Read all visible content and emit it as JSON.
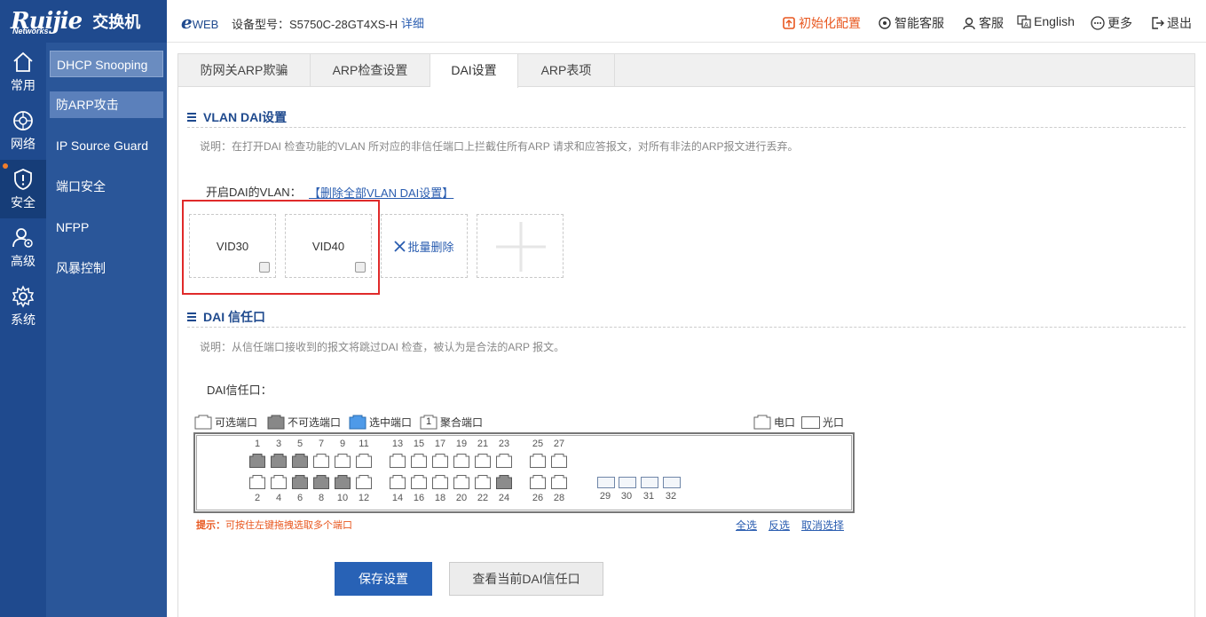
{
  "brand": {
    "logo": "Ruijie",
    "logo_sub": "Networks",
    "title": "交换机"
  },
  "rail": [
    {
      "label": "常用",
      "icon": "home-icon"
    },
    {
      "label": "网络",
      "icon": "network-icon"
    },
    {
      "label": "安全",
      "icon": "shield-icon",
      "active": true
    },
    {
      "label": "高级",
      "icon": "user-gear-icon"
    },
    {
      "label": "系统",
      "icon": "gear-icon"
    }
  ],
  "submenu": [
    "DHCP Snooping",
    "防ARP攻击",
    "IP Source Guard",
    "端口安全",
    "NFPP",
    "风暴控制"
  ],
  "topbar": {
    "eweb": "e",
    "eweb_suffix": "WEB",
    "model_label": "设备型号：",
    "model": "S5750C-28GT4XS-H",
    "detail": "详细",
    "init": "初始化配置",
    "smart_service": "智能客服",
    "service": "客服",
    "language": "English",
    "more": "更多",
    "logout": "退出"
  },
  "tabs": [
    "防网关ARP欺骗",
    "ARP检查设置",
    "DAI设置",
    "ARP表项"
  ],
  "vlan_section": {
    "title": "VLAN DAI设置",
    "note": "说明：在打开DAI 检查功能的VLAN 所对应的非信任端口上拦截住所有ARP 请求和应答报文，对所有非法的ARP报文进行丢弃。",
    "enabled_label": "开启DAI的VLAN：",
    "delete_all": "【删除全部VLAN DAI设置】",
    "vlans": [
      "VID30",
      "VID40"
    ],
    "batch_delete": "批量删除"
  },
  "trust_section": {
    "title": "DAI 信任口",
    "note": "说明：从信任端口接收到的报文将跳过DAI 检查，被认为是合法的ARP 报文。",
    "label": "DAI信任口："
  },
  "legend": {
    "selectable": "可选端口",
    "unselectable": "不可选端口",
    "selected": "选中端口",
    "aggregate_num": "1",
    "aggregate": "聚合端口",
    "electrical": "电口",
    "optical": "光口"
  },
  "ports": {
    "top_numbers": [
      "1",
      "3",
      "5",
      "7",
      "9",
      "11",
      "13",
      "15",
      "17",
      "19",
      "21",
      "23",
      "25",
      "27"
    ],
    "bottom_numbers": [
      "2",
      "4",
      "6",
      "8",
      "10",
      "12",
      "14",
      "16",
      "18",
      "20",
      "22",
      "24",
      "26",
      "28"
    ],
    "fiber_numbers": [
      "29",
      "30",
      "31",
      "32"
    ],
    "top_unselectable": [
      1,
      3,
      5
    ],
    "bottom_unselectable": [
      6,
      8,
      10,
      24
    ]
  },
  "tip": {
    "prefix": "提示：",
    "text": "可按住左键拖拽选取多个端口"
  },
  "select_links": {
    "all": "全选",
    "invert": "反选",
    "clear": "取消选择"
  },
  "buttons": {
    "save": "保存设置",
    "view": "查看当前DAI信任口"
  },
  "colors": {
    "brand": "#1f4a8e",
    "accent": "#2862b6",
    "warning": "#e8571f",
    "highlight": "#e02a2a"
  }
}
